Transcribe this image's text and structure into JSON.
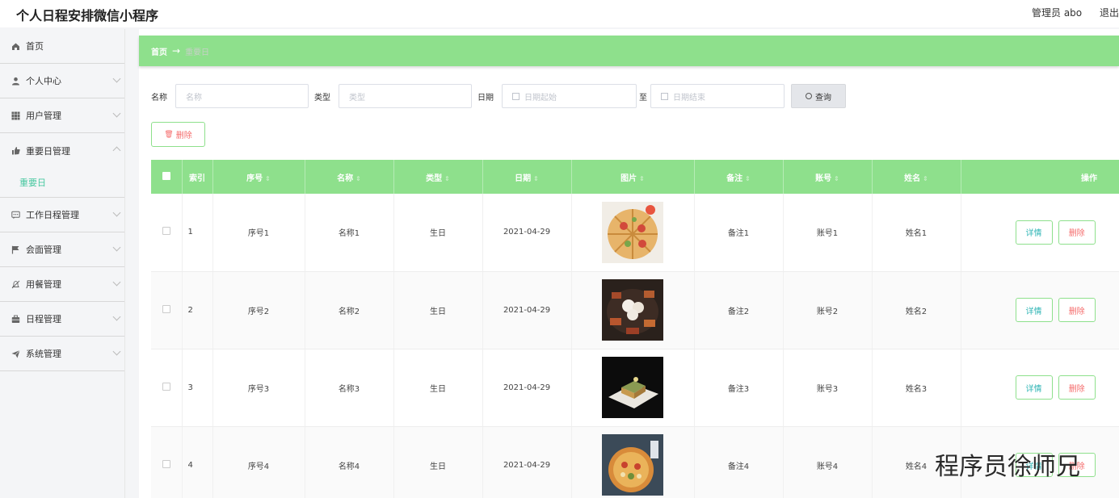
{
  "header": {
    "title": "个人日程安排微信小程序",
    "user_label": "管理员 abo",
    "logout_label": "退出"
  },
  "sidebar": {
    "items": [
      {
        "label": "首页",
        "icon": "home-icon"
      },
      {
        "label": "个人中心",
        "icon": "user-icon"
      },
      {
        "label": "用户管理",
        "icon": "grid-icon"
      },
      {
        "label": "重要日管理",
        "icon": "thumb-icon",
        "expanded": true,
        "sub": "重要日"
      },
      {
        "label": "工作日程管理",
        "icon": "chat-icon"
      },
      {
        "label": "会面管理",
        "icon": "flag-icon"
      },
      {
        "label": "用餐管理",
        "icon": "bell-off-icon"
      },
      {
        "label": "日程管理",
        "icon": "briefcase-icon"
      },
      {
        "label": "系统管理",
        "icon": "send-icon"
      }
    ]
  },
  "breadcrumb": {
    "home": "首页",
    "arrow": "→",
    "current": "重要日"
  },
  "search": {
    "name_label": "名称",
    "name_placeholder": "名称",
    "type_label": "类型",
    "type_placeholder": "类型",
    "date_label": "日期",
    "date_start_placeholder": "日期起始",
    "to_label": "至",
    "date_end_placeholder": "日期结束",
    "query_label": "查询"
  },
  "toolbar": {
    "delete_label": "删除"
  },
  "table": {
    "headers": [
      "索引",
      "序号",
      "名称",
      "类型",
      "日期",
      "图片",
      "备注",
      "账号",
      "姓名",
      "操作"
    ],
    "rows": [
      {
        "idx": "1",
        "seq": "序号1",
        "name": "名称1",
        "type": "生日",
        "date": "2021-04-29",
        "note": "备注1",
        "account": "账号1",
        "person": "姓名1"
      },
      {
        "idx": "2",
        "seq": "序号2",
        "name": "名称2",
        "type": "生日",
        "date": "2021-04-29",
        "note": "备注2",
        "account": "账号2",
        "person": "姓名2"
      },
      {
        "idx": "3",
        "seq": "序号3",
        "name": "名称3",
        "type": "生日",
        "date": "2021-04-29",
        "note": "备注3",
        "account": "账号3",
        "person": "姓名3"
      },
      {
        "idx": "4",
        "seq": "序号4",
        "name": "名称4",
        "type": "生日",
        "date": "2021-04-29",
        "note": "备注4",
        "account": "账号4",
        "person": "姓名4"
      }
    ],
    "detail_label": "详情",
    "delete_label": "删除"
  },
  "watermark": "程序员徐师兄",
  "colors": {
    "accent": "#8ee08c",
    "danger": "#f56c6c",
    "active_sub": "#48c8a0"
  }
}
